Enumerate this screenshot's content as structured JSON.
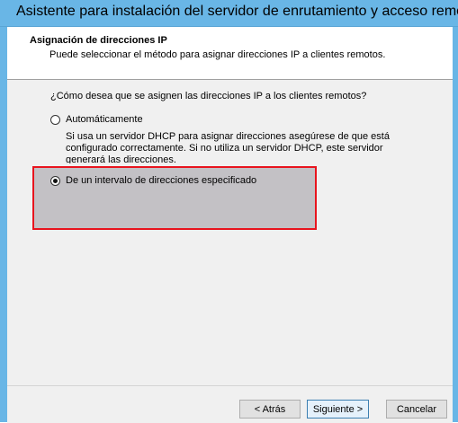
{
  "window": {
    "title": "Asistente para instalación del servidor de enrutamiento y acceso remoto"
  },
  "header": {
    "title": "Asignación de direcciones IP",
    "subtitle": "Puede seleccionar el método para asignar direcciones IP a clientes remotos."
  },
  "content": {
    "question": "¿Cómo desea que se asignen las direcciones IP a los clientes remotos?",
    "options": [
      {
        "label": "Automáticamente",
        "selected": false,
        "description": "Si usa un servidor DHCP para asignar direcciones asegúrese de que está configurado correctamente. Si no utiliza un servidor DHCP, este servidor generará las direcciones."
      },
      {
        "label": "De un intervalo de direcciones especificado",
        "selected": true
      }
    ]
  },
  "buttons": {
    "back": "< Atrás",
    "next": "Siguiente >",
    "cancel": "Cancelar"
  },
  "colors": {
    "titlebar": "#69b6e6",
    "highlight_border": "#e8141e",
    "highlight_fill": "#c3c1c5"
  }
}
